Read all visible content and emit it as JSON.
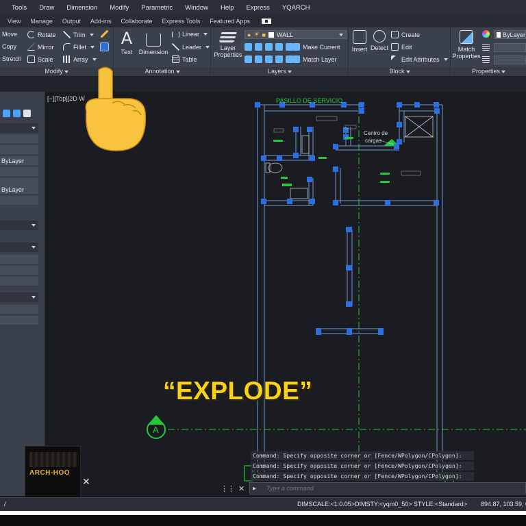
{
  "menubar": [
    "Tools",
    "Draw",
    "Dimension",
    "Modify",
    "Parametric",
    "Window",
    "Help",
    "Express",
    "YQARCH"
  ],
  "tabs": [
    "View",
    "Manage",
    "Output",
    "Add-ins",
    "Collaborate",
    "Express Tools",
    "Featured Apps"
  ],
  "modify": {
    "move": "Move",
    "rotate": "Rotate",
    "trim": "Trim",
    "copy": "Copy",
    "mirror": "Mirror",
    "fillet": "Fillet",
    "stretch": "Stretch",
    "scale": "Scale",
    "array": "Array",
    "title": "Modify"
  },
  "annotation": {
    "text": "Text",
    "dimension": "Dimension",
    "linear": "Linear",
    "leader": "Leader",
    "table": "Table",
    "title": "Annotation"
  },
  "layers": {
    "layer_properties": "Layer Properties",
    "current_layer": "WALL",
    "make_current": "Make Current",
    "match_layer": "Match Layer",
    "title": "Layers"
  },
  "block": {
    "insert": "Insert",
    "detect": "Detect",
    "create": "Create",
    "edit": "Edit",
    "edit_attributes": "Edit Attributes",
    "title": "Block"
  },
  "properties": {
    "match_properties": "Match Properties",
    "bylayer": "ByLayer",
    "title": "Properties"
  },
  "left_panel": {
    "row1": "ByLayer",
    "row2": "ByLayer"
  },
  "viewport": {
    "label": "[−][Top][2D W"
  },
  "plan": {
    "pasillo": "PASILLO DE SERVICIO",
    "centro": "Centro de",
    "cargas": "cargas",
    "grid_a": "A"
  },
  "command": {
    "history": [
      "Command: Specify opposite corner or [Fence/WPolygon/CPolygon]:",
      "Command: Specify opposite corner or [Fence/WPolygon/CPolygon]:",
      "Command: Specify opposite corner or [Fence/WPolygon/CPolygon]:"
    ],
    "placeholder": "Type a command"
  },
  "status": {
    "dimscale": "DIMSCALE:<1:0.05>",
    "dimsty": "DIMSTY:<yqm0_50>",
    "style": "STYLE:<Standard>",
    "coords": "894.87, 103.59, 0"
  },
  "overlay": {
    "caption": "“EXPLODE”",
    "logo": "ARCH-HOO"
  },
  "colors": {
    "wall": "#3b7fd9",
    "grip": "#2b6fe0",
    "green": "#22c93a",
    "caption": "#f6d21a"
  }
}
